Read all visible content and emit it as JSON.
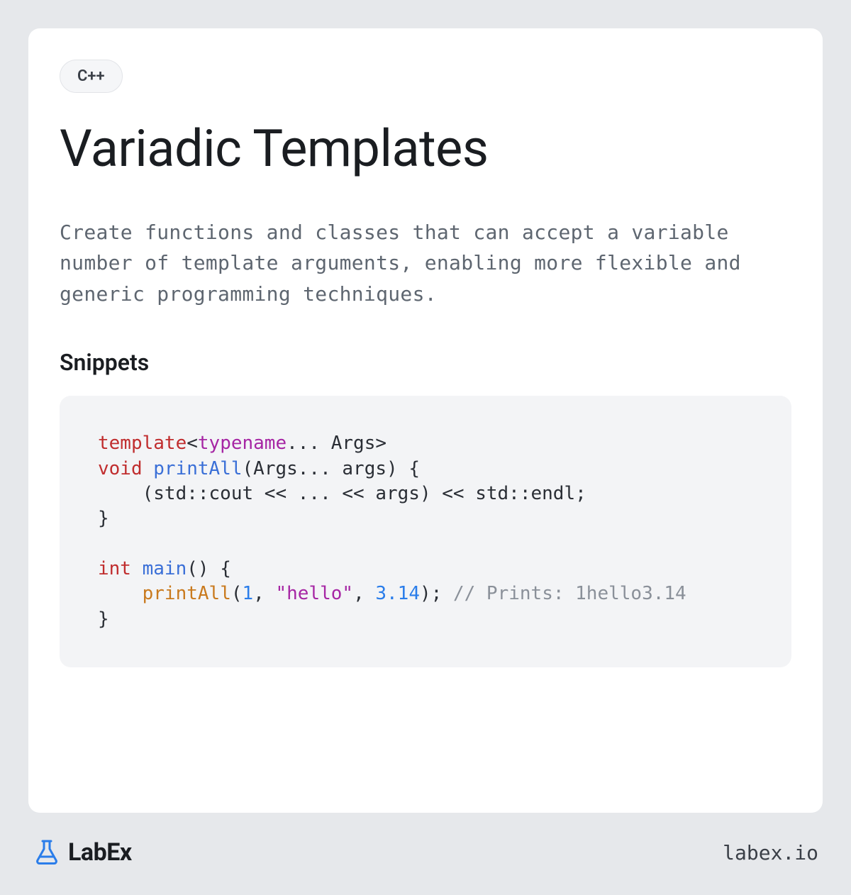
{
  "badge": "C++",
  "title": "Variadic Templates",
  "description": "Create functions and classes that can accept a variable number of template arguments, enabling more flexible and generic programming techniques.",
  "snippets_heading": "Snippets",
  "code": {
    "tokens": [
      {
        "t": "keyword",
        "v": "template"
      },
      {
        "t": "plain",
        "v": "<"
      },
      {
        "t": "typename",
        "v": "typename"
      },
      {
        "t": "plain",
        "v": "... Args>\n"
      },
      {
        "t": "keyword",
        "v": "void"
      },
      {
        "t": "plain",
        "v": " "
      },
      {
        "t": "func-def",
        "v": "printAll"
      },
      {
        "t": "plain",
        "v": "(Args... args) {\n    (std::cout << ... << args) << std::endl;\n}\n\n"
      },
      {
        "t": "type",
        "v": "int"
      },
      {
        "t": "plain",
        "v": " "
      },
      {
        "t": "func-def",
        "v": "main"
      },
      {
        "t": "plain",
        "v": "() {\n    "
      },
      {
        "t": "func-call",
        "v": "printAll"
      },
      {
        "t": "plain",
        "v": "("
      },
      {
        "t": "number",
        "v": "1"
      },
      {
        "t": "plain",
        "v": ", "
      },
      {
        "t": "string",
        "v": "\"hello\""
      },
      {
        "t": "plain",
        "v": ", "
      },
      {
        "t": "number",
        "v": "3.14"
      },
      {
        "t": "plain",
        "v": "); "
      },
      {
        "t": "comment",
        "v": "// Prints: 1hello3.14"
      },
      {
        "t": "plain",
        "v": "\n}"
      }
    ]
  },
  "footer": {
    "brand": "LabEx",
    "domain": "labex.io"
  },
  "colors": {
    "page_bg": "#e6e8eb",
    "card_bg": "#ffffff",
    "code_bg": "#f3f4f6",
    "accent_blue": "#2a7dea"
  }
}
